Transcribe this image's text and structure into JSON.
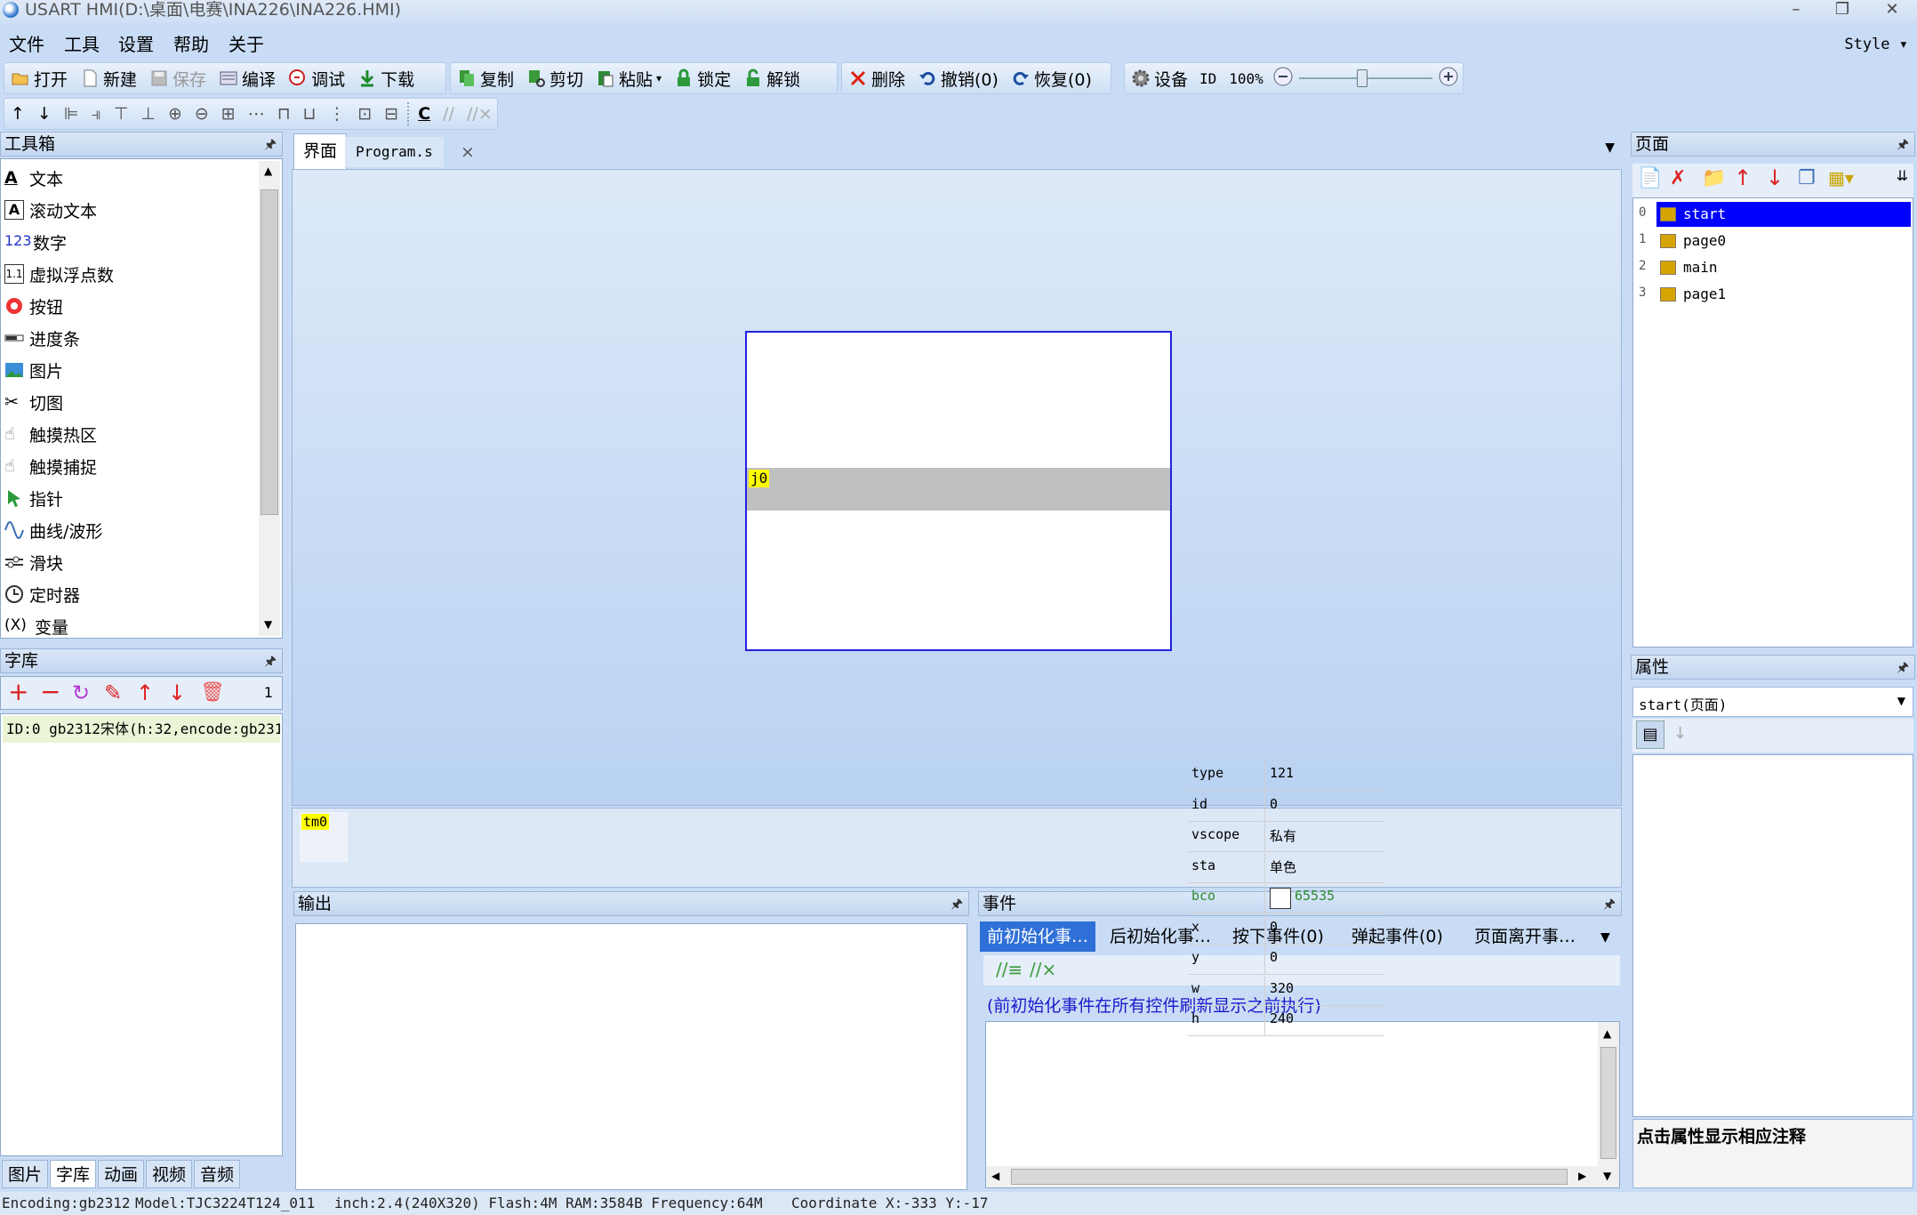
{
  "window": {
    "title": "USART HMI(D:\\桌面\\电赛\\INA226\\INA226.HMI)",
    "minimize": "–",
    "restore": "❐",
    "close": "✕"
  },
  "menu": {
    "items": [
      "文件",
      "工具",
      "设置",
      "帮助",
      "关于"
    ],
    "style": "Style ▾"
  },
  "toolbar1": {
    "open": "打开",
    "new": "新建",
    "save": "保存",
    "compile": "编译",
    "debug": "调试",
    "download": "下载",
    "copy": "复制",
    "cut": "剪切",
    "paste": "粘贴",
    "lock": "锁定",
    "unlock": "解锁",
    "delete": "删除",
    "undo": "撤销(0)",
    "redo": "恢复(0)",
    "device": "设备",
    "id": "ID",
    "zoom": "100%",
    "zoom_level": 0.47
  },
  "toolbox": {
    "title": "工具箱",
    "items": [
      "文本",
      "滚动文本",
      "数字",
      "虚拟浮点数",
      "按钮",
      "进度条",
      "图片",
      "切图",
      "触摸热区",
      "触摸捕捉",
      "指针",
      "曲线/波形",
      "滑块",
      "定时器",
      "变量"
    ]
  },
  "fontlib": {
    "title": "字库",
    "count": "1",
    "entry": "ID:0   gb2312宋体(h:32,encode:gb231"
  },
  "left_tabs": [
    "图片",
    "字库",
    "动画",
    "视频",
    "音频"
  ],
  "editor": {
    "tabs": [
      "界面",
      "Program.s"
    ],
    "tab_close": "×",
    "canvas_component": "j0",
    "timer_component": "tm0"
  },
  "output": {
    "title": "输出"
  },
  "events": {
    "title": "事件",
    "tabs": [
      "前初始化事…",
      "后初始化事…",
      "按下事件(0)",
      "弹起事件(0)",
      "页面离开事…"
    ],
    "hint": "(前初始化事件在所有控件刷新显示之前执行)"
  },
  "pages": {
    "title": "页面",
    "list": [
      {
        "index": "0",
        "name": "start"
      },
      {
        "index": "1",
        "name": "page0"
      },
      {
        "index": "2",
        "name": "main"
      },
      {
        "index": "3",
        "name": "page1"
      }
    ]
  },
  "props": {
    "title": "属性",
    "selector": "start(页面)",
    "rows": [
      {
        "key": "type",
        "value": "121"
      },
      {
        "key": "id",
        "value": "0"
      },
      {
        "key": "vscope",
        "value": "私有"
      },
      {
        "key": "sta",
        "value": "单色"
      },
      {
        "key": "bco",
        "value": "65535"
      },
      {
        "key": "x",
        "value": "0"
      },
      {
        "key": "y",
        "value": "0"
      },
      {
        "key": "w",
        "value": "320"
      },
      {
        "key": "h",
        "value": "240"
      }
    ],
    "note": "点击属性显示相应注释",
    "bco_color": "#2e8b2e"
  },
  "status": {
    "encoding": "Encoding:gb2312",
    "model": "Model:TJC3224T124_011",
    "spec": "inch:2.4(240X320) Flash:4M RAM:3584B Frequency:64M",
    "coord": "Coordinate X:-333  Y:-17"
  },
  "colors": {
    "accent": "#0000ff",
    "canvas_bg": "#ffffff",
    "progress_bg": "#c0c0c0",
    "label_bg": "#ffff00"
  }
}
